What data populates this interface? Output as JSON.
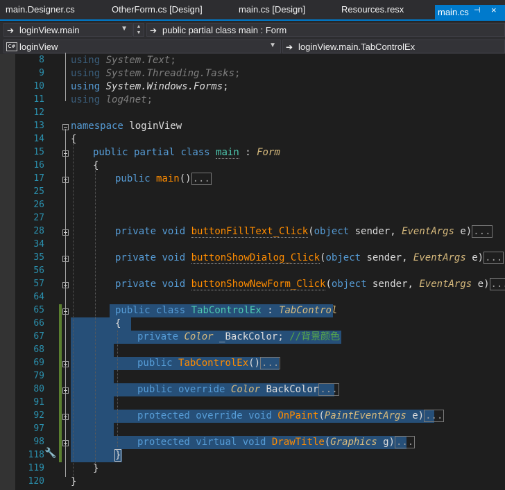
{
  "tabs": [
    {
      "label": "main.Designer.cs",
      "active": false
    },
    {
      "label": "OtherForm.cs [Design]",
      "active": false
    },
    {
      "label": "main.cs [Design]",
      "active": false
    },
    {
      "label": "Resources.resx",
      "active": false
    },
    {
      "label": "main.cs",
      "active": true
    }
  ],
  "tab_pin": "⊣",
  "tab_close": "×",
  "nav": {
    "project": "loginView.main",
    "member": "public partial class main : Form",
    "scope": "loginView",
    "scope_icon": "C#",
    "type": "loginView.main.TabControlEx"
  },
  "line_numbers": [
    "8",
    "9",
    "10",
    "11",
    "12",
    "13",
    "14",
    "15",
    "16",
    "17",
    "25",
    "26",
    "27",
    "28",
    "34",
    "35",
    "56",
    "57",
    "64",
    "65",
    "66",
    "67",
    "68",
    "69",
    "79",
    "80",
    "91",
    "92",
    "97",
    "98",
    "118",
    "119",
    "120"
  ],
  "code": {
    "kw_using": "using",
    "ns_text": "System.Text",
    "ns_tasks": "System.Threading.Tasks",
    "ns_forms": "System.Windows.Forms",
    "ns_log": "log4net",
    "semi": ";",
    "kw_namespace": "namespace",
    "namespace_name": "loginView",
    "brace_open": "{",
    "brace_close": "}",
    "kw_public": "public",
    "kw_private": "private",
    "kw_protected": "protected",
    "kw_partial": "partial",
    "kw_class": "class",
    "kw_void": "void",
    "kw_object": "object",
    "kw_override": "override",
    "kw_virtual": "virtual",
    "class_main": "main",
    "colon": " : ",
    "form": "Form",
    "ctor_main": "main",
    "parens": "()",
    "ellipsis": "...",
    "m_fill": "buttonFillText_Click",
    "m_dialog": "buttonShowDialog_Click",
    "m_newform": "buttonShowNewForm_Click",
    "param_open": "(",
    "param_close": ")",
    "p_sender": " sender, ",
    "eventargs": "EventArgs",
    "p_e": " e",
    "class_tab": "TabControlEx",
    "tabcontrol": "TabControl",
    "color": "Color",
    "backcolor_field": " _BackColor; ",
    "comment": "//背景颜色",
    "ctor_tab": "TabControlEx",
    "backcolor_prop": "BackColor",
    "onpaint": "OnPaint",
    "painteventargs": "PaintEventArgs",
    "drawtitle": "DrawTitle",
    "graphics": "Graphics",
    "p_g": " g"
  },
  "colors": {
    "keyword": "#569cd6",
    "type": "#4ec9b0",
    "method": "#ff8c00",
    "selection": "#264f78",
    "line_number": "#2b91af",
    "accent": "#007acc"
  },
  "icons": {
    "nav_arrow": "arrow-right-icon",
    "wrench": "wrench-icon"
  }
}
